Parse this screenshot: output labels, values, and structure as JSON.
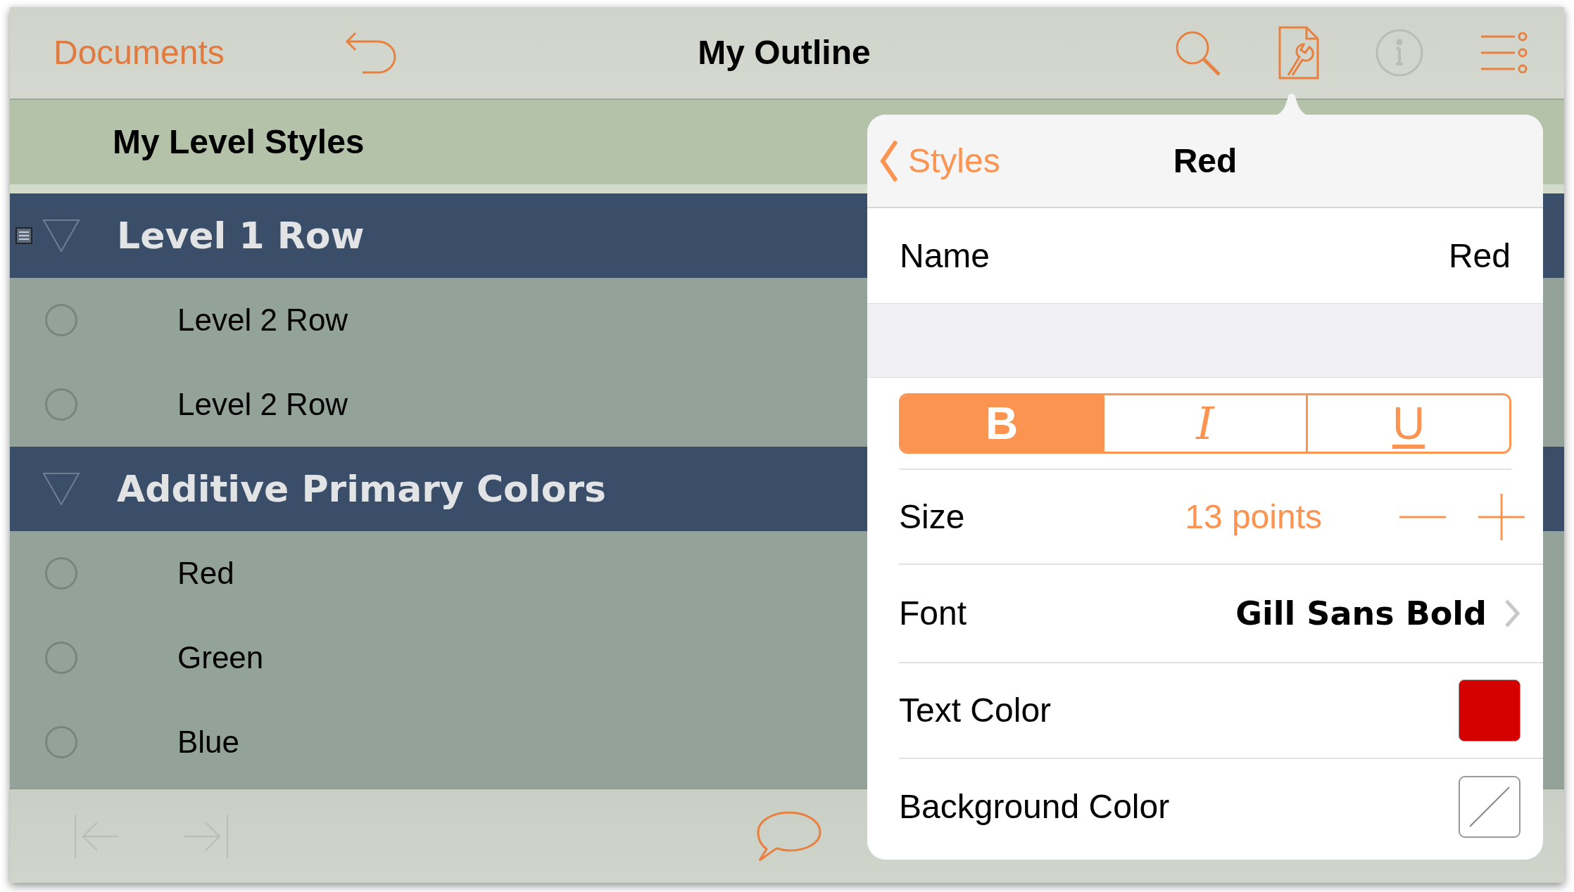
{
  "toolbar": {
    "back_link": "Documents",
    "title": "My Outline",
    "buttons": [
      {
        "kind": "undo",
        "disabled": false
      },
      {
        "kind": "search",
        "disabled": false
      },
      {
        "kind": "inspector",
        "disabled": false
      },
      {
        "kind": "info",
        "disabled": true
      },
      {
        "kind": "menu",
        "disabled": false
      }
    ]
  },
  "section_title": "My Level Styles",
  "outline": [
    {
      "text": "Level 1 Row",
      "expanded": true,
      "has_note": true,
      "children": [
        {
          "text": "Level 2 Row"
        },
        {
          "text": "Level 2 Row"
        }
      ]
    },
    {
      "text": "Additive Primary Colors",
      "expanded": true,
      "has_note": false,
      "children": [
        {
          "text": "Red"
        },
        {
          "text": "Green"
        },
        {
          "text": "Blue"
        }
      ]
    }
  ],
  "bottom_bar": {
    "buttons": [
      {
        "kind": "outdent",
        "disabled": true
      },
      {
        "kind": "indent",
        "disabled": true
      },
      {
        "kind": "comment",
        "disabled": false
      }
    ]
  },
  "popover": {
    "back": "Styles",
    "title": "Red",
    "name": {
      "label": "Name",
      "value": "Red"
    },
    "style_buttons": [
      {
        "label": "B",
        "kind": "bold",
        "selected": true
      },
      {
        "label": "I",
        "kind": "italic",
        "selected": false
      },
      {
        "label": "U",
        "kind": "underline",
        "selected": false
      }
    ],
    "size": {
      "label": "Size",
      "value": "13 points"
    },
    "font": {
      "label": "Font",
      "value": "Gill Sans Bold"
    },
    "colors": [
      {
        "label": "Text Color",
        "color": "#d40000"
      },
      {
        "label": "Background Color"
      }
    ]
  }
}
